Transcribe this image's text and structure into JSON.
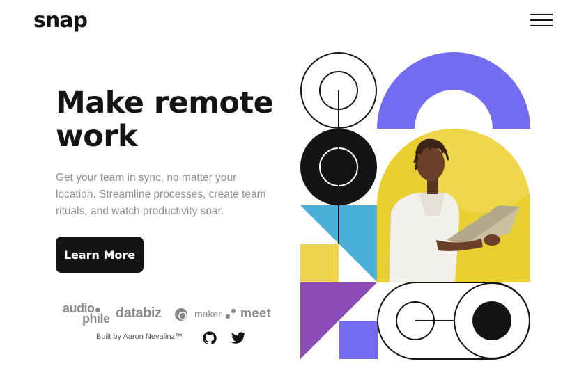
{
  "header": {
    "logo": "snap",
    "menu_icon": "hamburger-menu-icon"
  },
  "hero": {
    "title_line1": "Make remote",
    "title_line2": "work",
    "description": "Get your team in sync, no matter your location. Streamline processes, create team rituals, and watch productivity soar.",
    "cta_label": "Learn More"
  },
  "clients": {
    "audiophile_top": "audio",
    "audiophile_bottom": "phile",
    "databiz": "databiz",
    "maker": "maker",
    "meet": "meet"
  },
  "footer": {
    "attribution": "Built by Aaron Nevalinz™",
    "social_icons": [
      "github-icon",
      "twitter-icon"
    ]
  },
  "colors": {
    "ink": "#141414",
    "muted": "#8f8f8f",
    "purple": "#736cf0",
    "blue": "#4aafd9",
    "yellow": "#efd54d",
    "violet": "#8b4cb7",
    "photo_bg": "#e9cf32"
  }
}
